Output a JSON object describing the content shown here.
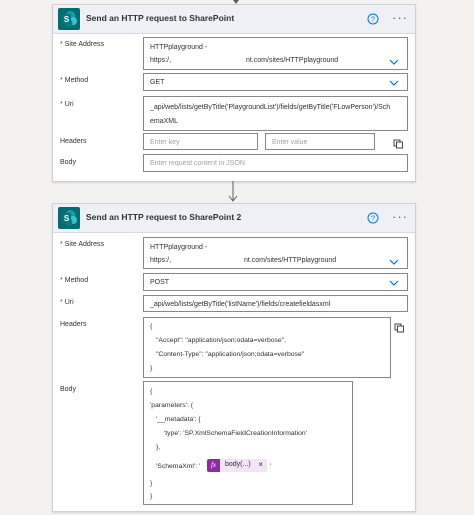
{
  "actions": [
    {
      "title": "Send an HTTP request to SharePoint",
      "fields": {
        "site_address": {
          "label": "Site Address",
          "line1": "HTTPplayground -",
          "line2_prefix": "https:/,",
          "line2_suffix": "nt.com/sites/HTTPplayground"
        },
        "method": {
          "label": "Method",
          "value": "GET"
        },
        "uri": {
          "label": "Uri",
          "line1": "_api/web/lists/getByTitle('PlaygroundList')/fields/getByTitle('FLowPerson')/Sch",
          "line2": "emaXML"
        },
        "headers": {
          "label": "Headers",
          "key_placeholder": "Enter key",
          "value_placeholder": "Enter value"
        },
        "body": {
          "label": "Body",
          "placeholder": "Enter request content in JSON"
        }
      }
    },
    {
      "title": "Send an HTTP request to SharePoint 2",
      "fields": {
        "site_address": {
          "label": "Site Address",
          "line1": "HTTPplayground -",
          "line2_prefix": "https:/,",
          "line2_suffix": "nt.com/sites/HTTPplayground"
        },
        "method": {
          "label": "Method",
          "value": "POST"
        },
        "uri": {
          "label": "Uri",
          "line1": "_api/web/lists/getByTitle('listName')/fields/createfieldasxml"
        },
        "headers": {
          "label": "Headers",
          "lines": [
            "{",
            "\"Accept\": \"application/json;odata=verbose\",",
            "\"Content-Type\": \"application/json;odata=verbose\"",
            "}"
          ]
        },
        "body": {
          "label": "Body",
          "lines": [
            "{",
            "'parameters': {",
            "'__metadata': {",
            "'type': 'SP.XmlSchemaFieldCreationInformation'",
            "},",
            "'SchemaXml': '",
            "}",
            "}"
          ],
          "token": {
            "label": "body(...)",
            "close": "×",
            "trailing": "'"
          }
        }
      }
    }
  ],
  "required_marker": "*",
  "colors": {
    "sharepoint": "#036c70",
    "header_bg": "#eef0f6",
    "accent_blue": "#0078d4",
    "token_fx": "#8a2da5",
    "token_bg": "#f4e4f7"
  },
  "icons": {
    "sharepoint": "sharepoint-icon",
    "help": "help-circle-icon",
    "more": "more-options-icon",
    "chevron": "chevron-down-icon",
    "switch_mode": "switch-text-mode-icon",
    "arrow": "arrow-down-icon",
    "expression": "fx-icon"
  },
  "more_glyph": "···",
  "fx_glyph": "fx"
}
